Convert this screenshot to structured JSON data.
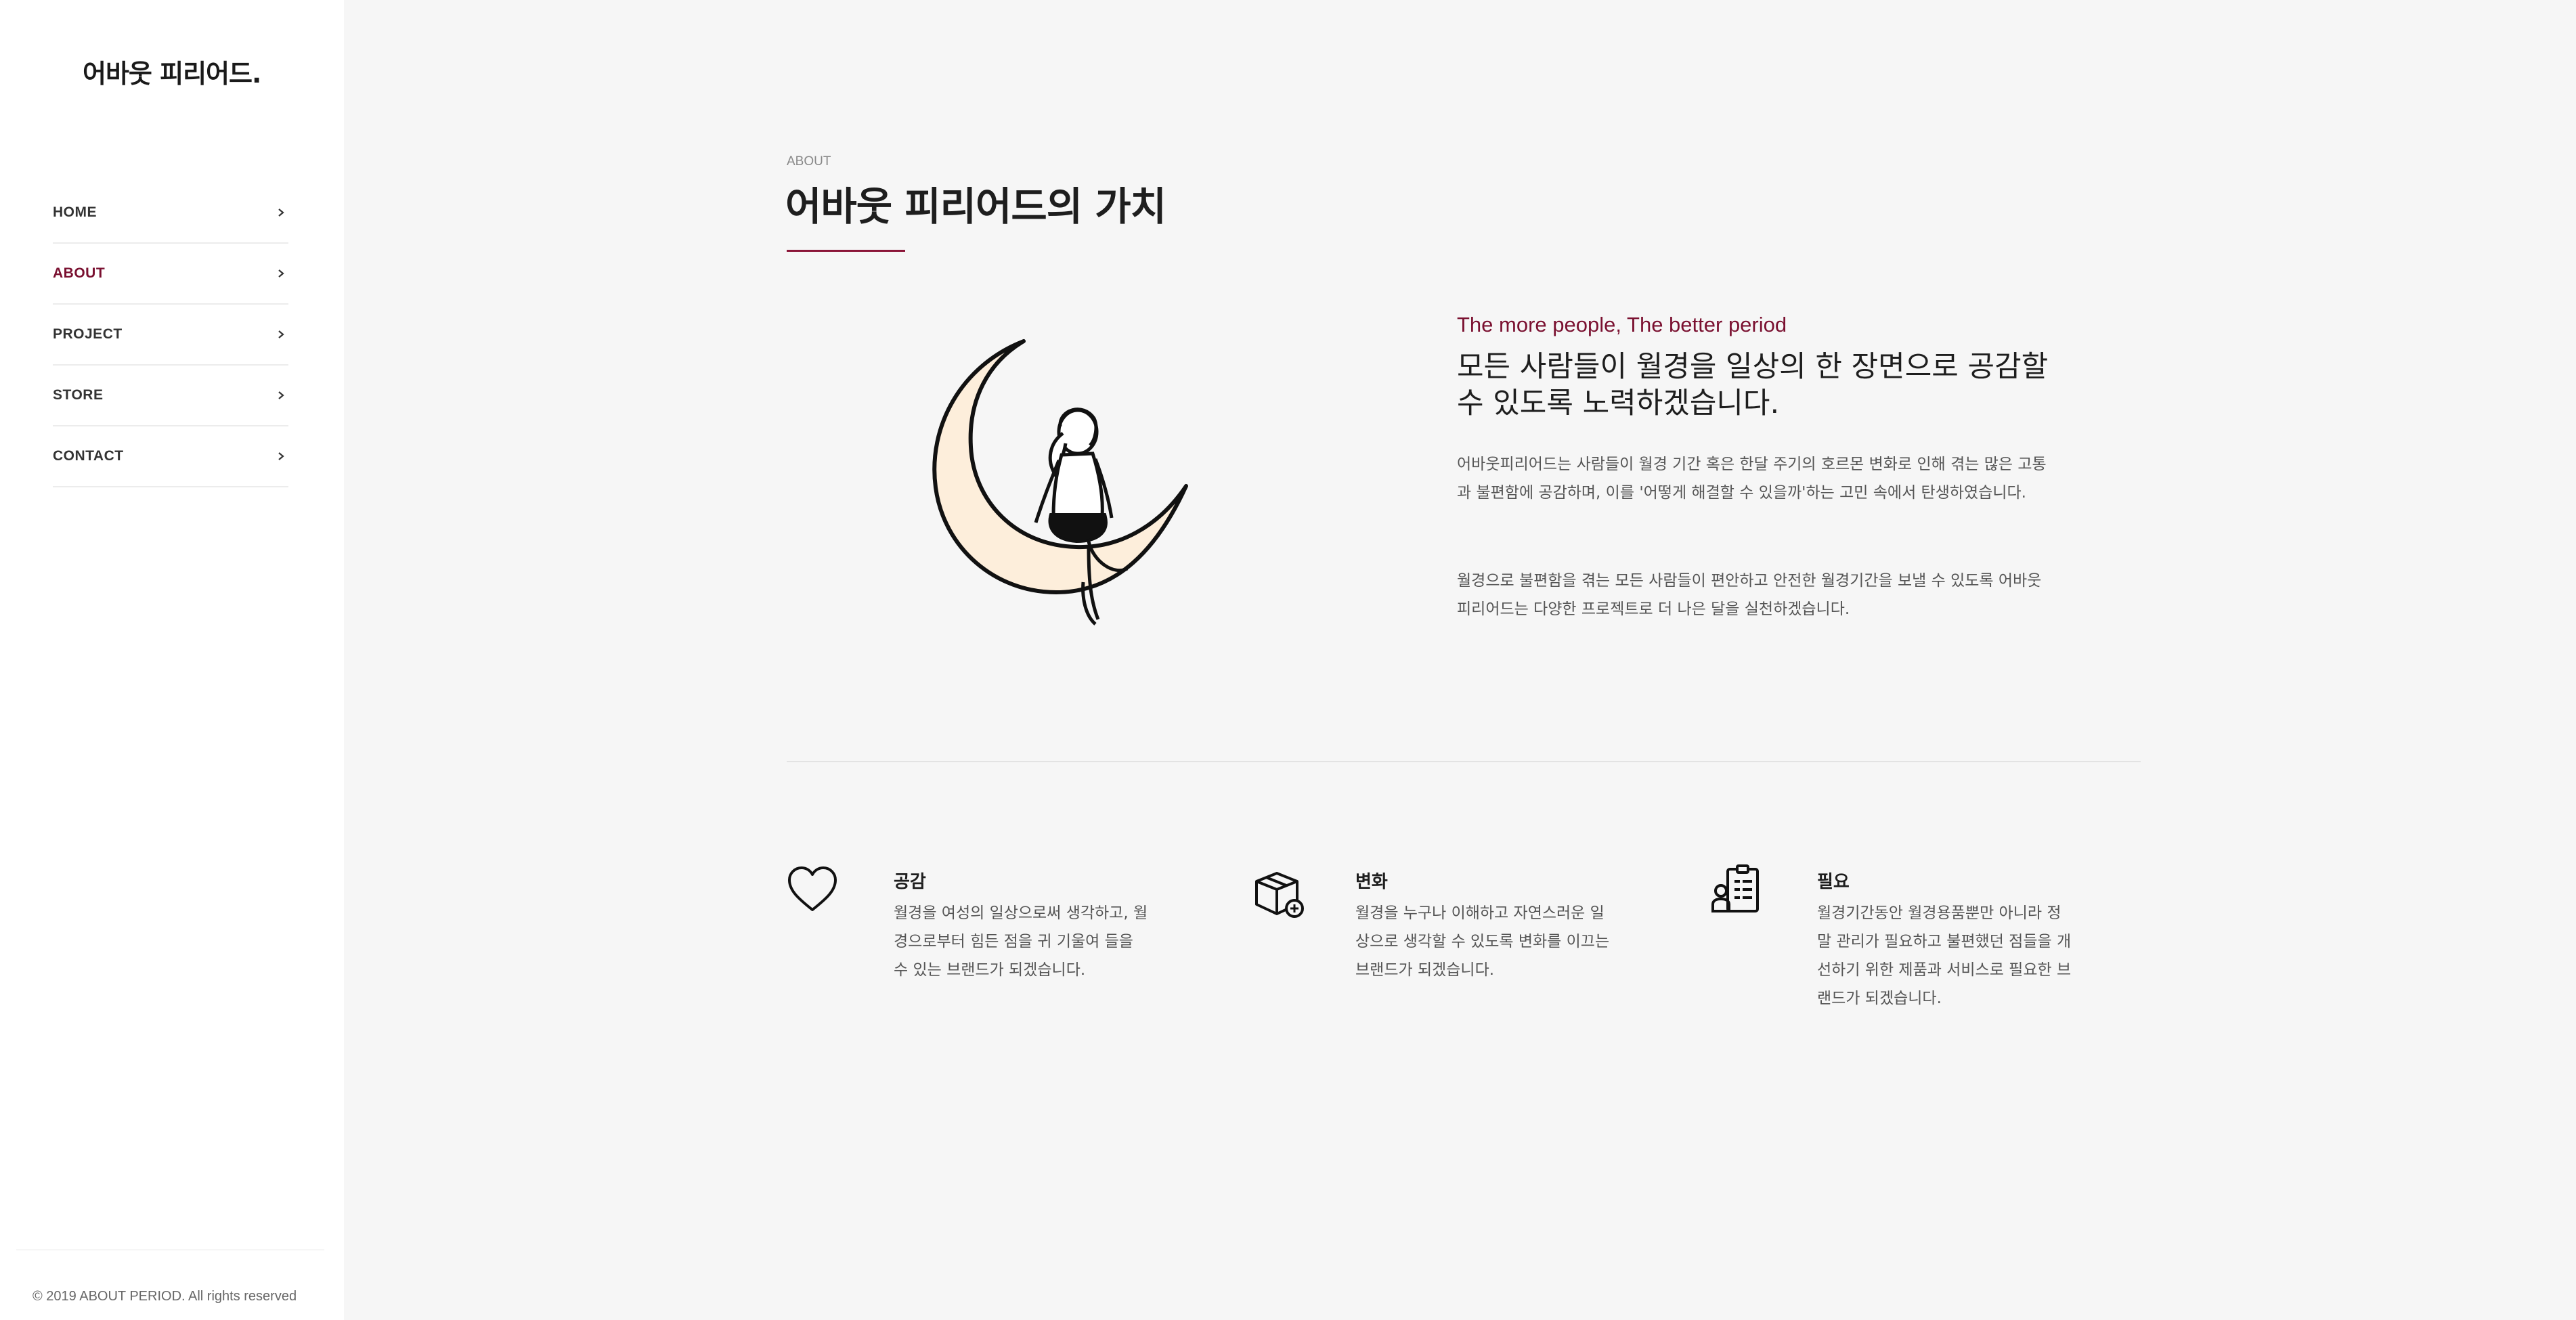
{
  "sidebar": {
    "logo": "어바웃 피리어드.",
    "nav": [
      {
        "label": "HOME",
        "active": false
      },
      {
        "label": "ABOUT",
        "active": true
      },
      {
        "label": "PROJECT",
        "active": false
      },
      {
        "label": "STORE",
        "active": false
      },
      {
        "label": "CONTACT",
        "active": false
      }
    ],
    "copyright": "© 2019 ABOUT PERIOD. All rights reserved"
  },
  "main": {
    "eyebrow": "ABOUT",
    "title": "어바웃 피리어드의 가치",
    "tagline": "The more people, The better period",
    "headline_line1": "모든 사람들이 월경을 일상의 한 장면으로 공감할",
    "headline_line2": "수 있도록 노력하겠습니다.",
    "paragraph1": "어바웃피리어드는 사람들이 월경 기간 혹은 한달 주기의 호르몬 변화로 인해 겪는 많은 고통과 불편함에 공감하며, 이를 '어떻게 해결할 수 있을까'하는 고민 속에서 탄생하였습니다.",
    "paragraph2": "월경으로 불편함을 겪는 모든 사람들이 편안하고 안전한 월경기간을 보낼 수 있도록 어바웃 피리어드는 다양한 프로젝트로 더 나은 달을 실천하겠습니다."
  },
  "features": [
    {
      "icon": "heart-icon",
      "title": "공감",
      "description": "월경을 여성의 일상으로써 생각하고, 월경으로부터 힘든 점을 귀 기울여 들을 수 있는 브랜드가 되겠습니다."
    },
    {
      "icon": "package-icon",
      "title": "변화",
      "description": "월경을 누구나 이해하고 자연스러운 일상으로 생각할 수 있도록 변화를 이끄는 브랜드가 되겠습니다."
    },
    {
      "icon": "clipboard-icon",
      "title": "필요",
      "description": "월경기간동안 월경용품뿐만 아니라 정말 관리가 필요하고 불편했던 점들을 개선하기 위한 제품과 서비스로 필요한 브랜드가 되겠습니다."
    }
  ],
  "colors": {
    "accent": "#8b1538",
    "sidebar_bg": "#ffffff",
    "page_bg": "#f6f6f6",
    "moon_fill": "#fdeedb"
  }
}
